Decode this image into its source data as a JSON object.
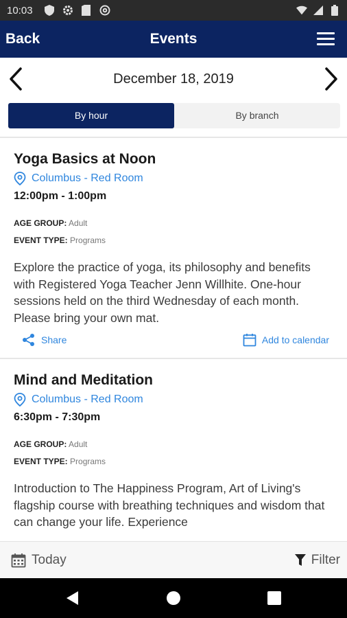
{
  "status_bar": {
    "time": "10:03",
    "icons_left": [
      "shield-icon",
      "gear-icon",
      "sim-icon",
      "at-icon"
    ],
    "icons_right": [
      "wifi-icon",
      "signal-icon",
      "battery-icon"
    ]
  },
  "app_bar": {
    "back_label": "Back",
    "title": "Events",
    "menu_icon": "hamburger-menu-icon",
    "background_color": "#0c2461"
  },
  "date_nav": {
    "date": "December 18, 2019"
  },
  "segment": {
    "by_hour": "By hour",
    "by_branch": "By branch",
    "selected": "By hour"
  },
  "events": [
    {
      "title": "Yoga Basics at Noon",
      "location": "Columbus - Red Room",
      "time": "12:00pm - 1:00pm",
      "age_group_label": "AGE GROUP:",
      "age_group": "Adult",
      "event_type_label": "EVENT TYPE:",
      "event_type": "Programs",
      "description": "Explore the practice of yoga, its philosophy and benefits with Registered Yoga Teacher Jenn Willhite. One-hour sessions held on the third Wednesday of each month. Please bring your own mat.",
      "share_label": "Share",
      "calendar_label": "Add to calendar"
    },
    {
      "title": "Mind and Meditation",
      "location": "Columbus - Red Room",
      "time": "6:30pm - 7:30pm",
      "age_group_label": "AGE GROUP:",
      "age_group": "Adult",
      "event_type_label": "EVENT TYPE:",
      "event_type": "Programs",
      "description": "Introduction to The Happiness Program, Art of Living's flagship course with breathing techniques and wisdom that can change your life. Experience"
    }
  ],
  "bottom_bar": {
    "today_label": "Today",
    "filter_label": "Filter"
  },
  "colors": {
    "accent": "#2f86de",
    "primary": "#0c2461"
  }
}
